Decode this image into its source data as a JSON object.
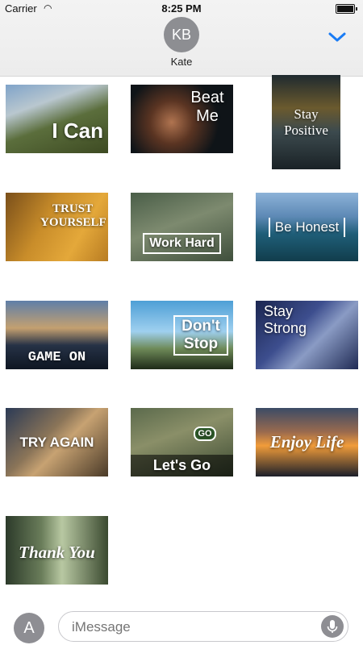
{
  "status": {
    "carrier": "Carrier",
    "time": "8:25 PM"
  },
  "header": {
    "avatar_initials": "KB",
    "contact_name": "Kate"
  },
  "stickers": [
    {
      "label": "I Can"
    },
    {
      "label": "Beat Me"
    },
    {
      "label": "Stay Positive"
    },
    {
      "label": "TRUST YOURSELF"
    },
    {
      "label": "Work Hard"
    },
    {
      "label": "Be Honest"
    },
    {
      "label": "GAME ON"
    },
    {
      "label": "Don't Stop"
    },
    {
      "label": "Stay Strong"
    },
    {
      "label": "TRY AGAIN"
    },
    {
      "label": "Let's Go",
      "badge": "GO"
    },
    {
      "label": "Enjoy Life"
    },
    {
      "label": "Thank You"
    }
  ],
  "composer": {
    "placeholder": "iMessage"
  },
  "colors": {
    "accent": "#1a7cf5"
  }
}
